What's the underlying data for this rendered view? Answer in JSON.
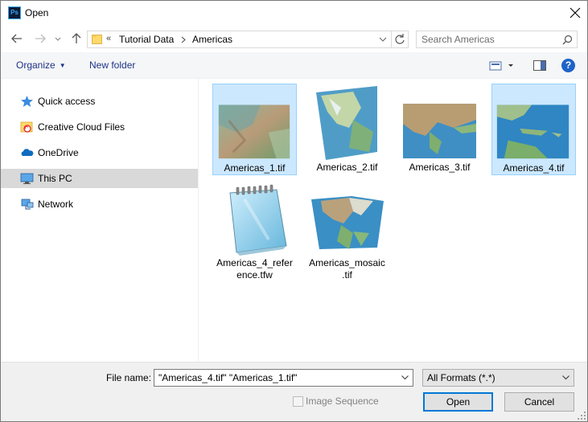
{
  "window": {
    "title": "Open",
    "app_icon_text": "Ps"
  },
  "address": {
    "overflow": "«",
    "crumbs": [
      "Tutorial Data",
      "Americas"
    ]
  },
  "search": {
    "placeholder": "Search Americas"
  },
  "toolbar": {
    "organize_label": "Organize",
    "new_folder_label": "New folder",
    "help_label": "?"
  },
  "sidebar": {
    "items": [
      {
        "label": "Quick access",
        "icon": "star-icon"
      },
      {
        "label": "Creative Cloud Files",
        "icon": "creative-cloud-folder-icon"
      },
      {
        "label": "OneDrive",
        "icon": "cloud-icon"
      },
      {
        "label": "This PC",
        "icon": "monitor-icon",
        "selected": true
      },
      {
        "label": "Network",
        "icon": "network-icon"
      }
    ]
  },
  "files": [
    {
      "name": "Americas_1.tif",
      "selected": true,
      "kind": "map-thumbnail"
    },
    {
      "name": "Americas_2.tif",
      "selected": false,
      "kind": "map-thumbnail"
    },
    {
      "name": "Americas_3.tif",
      "selected": false,
      "kind": "map-thumbnail"
    },
    {
      "name": "Americas_4.tif",
      "selected": true,
      "kind": "map-thumbnail"
    },
    {
      "name_line1": "Americas_4_refer",
      "name_line2": "ence.tfw",
      "selected": false,
      "kind": "notepad-icon"
    },
    {
      "name_line1": "Americas_mosaic",
      "name_line2": ".tif",
      "selected": false,
      "kind": "map-thumbnail"
    }
  ],
  "footer": {
    "file_name_label": "File name:",
    "file_name_value": "\"Americas_4.tif\" \"Americas_1.tif\"",
    "format_value": "All Formats (*.*)",
    "image_sequence_label": "Image Sequence",
    "open_label": "Open",
    "cancel_label": "Cancel"
  },
  "colors": {
    "accent": "#0078d7",
    "selection_fill": "#cce8ff",
    "selection_border": "#99d1ff",
    "link_blue": "#1e3287"
  }
}
